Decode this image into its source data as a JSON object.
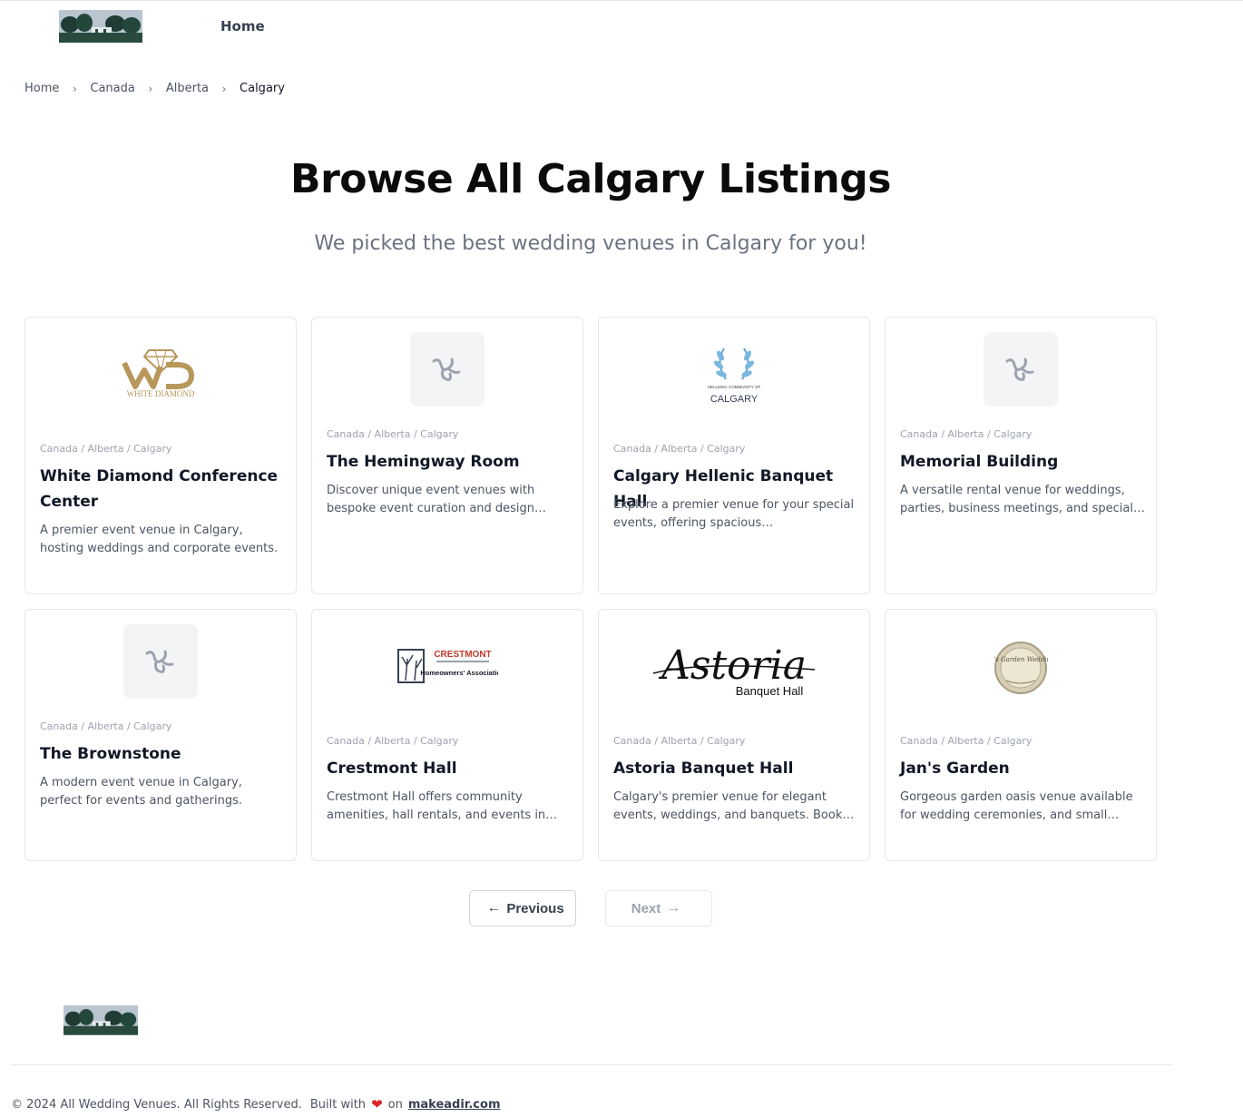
{
  "header": {
    "nav_home": "Home"
  },
  "breadcrumb": [
    "Home",
    "Canada",
    "Alberta",
    "Calgary"
  ],
  "hero": {
    "title": "Browse All Calgary Listings",
    "subtitle": "We picked the best wedding venues in Calgary for you!"
  },
  "listings": [
    {
      "crumbs": "Canada / Alberta / Calgary",
      "name": "White Diamond Conference Center",
      "description": "A premier event venue in Calgary, hosting weddings and corporate events.",
      "logo_text": "WHITE DIAMOND"
    },
    {
      "crumbs": "Canada / Alberta / Calgary",
      "name": "The Hemingway Room",
      "description": "Discover unique event venues with bespoke event curation and design services in Calgary."
    },
    {
      "crumbs": "Canada / Alberta / Calgary",
      "name": "Calgary Hellenic Banquet Hall",
      "description": "Explore a premier venue for your special events, offering spacious accommodations in Calgary.",
      "logo_text": "CALGARY",
      "logo_small_text": "HELLENIC COMMUNITY OF"
    },
    {
      "crumbs": "Canada / Alberta / Calgary",
      "name": "Memorial Building",
      "description": "A versatile rental venue for weddings, parties, business meetings, and special events."
    },
    {
      "crumbs": "Canada / Alberta / Calgary",
      "name": "The Brownstone",
      "description": "A modern event venue in Calgary, perfect for events and gatherings."
    },
    {
      "crumbs": "Canada / Alberta / Calgary",
      "name": "Crestmont Hall",
      "description": "Crestmont Hall offers community amenities, hall rentals, and events in Calgary.",
      "logo_text": "CRESTMONT",
      "logo_sub_text": "Homeowners' Association"
    },
    {
      "crumbs": "Canada / Alberta / Calgary",
      "name": "Astoria Banquet Hall",
      "description": "Calgary's premier venue for elegant events, weddings, and banquets. Book today.",
      "logo_text": "Astoria",
      "logo_sub_text": "Banquet Hall"
    },
    {
      "crumbs": "Canada / Alberta / Calgary",
      "name": "Jan's Garden",
      "description": "Gorgeous garden oasis venue available for wedding ceremonies, and small gatherings.",
      "logo_text": "Jan's Garden Weddings"
    }
  ],
  "pagination": {
    "previous": "Previous",
    "next": "Next"
  },
  "footer": {
    "copyright": "© 2024 All Wedding Venues. All Rights Reserved.",
    "built_with": "Built with",
    "on": "on",
    "brand": "makeadir.com"
  },
  "colors": {
    "heart": "#dc2626",
    "text_primary": "#111827",
    "text_muted": "#6b7280",
    "border": "#e5e7eb",
    "gold": "#b8975a"
  }
}
